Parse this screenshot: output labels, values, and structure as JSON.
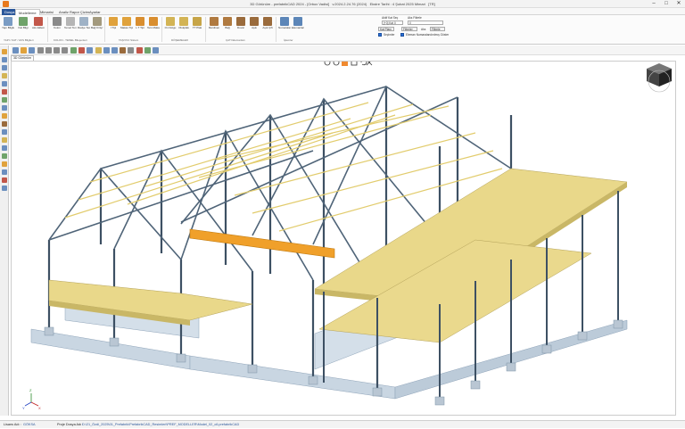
{
  "app": {
    "title": "3D Görünüm - prefabrikCAD 2024 - [Orbox Vadisi]",
    "version": "v.2024.2.24.76 (2024)",
    "license": "Ekstre Tarihi : 4 Şubat 2025 Mimari",
    "mode": "[TR]",
    "window_controls": [
      "–",
      "□",
      "✕"
    ]
  },
  "menu_tabs": [
    "Dosya",
    "Modelleme",
    "Mimarisi",
    "Analiz Rapor Çizim",
    "Ayarlar"
  ],
  "ribbon": {
    "buttons": [
      {
        "label": "Yapı Bilgileri",
        "icon": "building-icon"
      },
      {
        "label": "Kat Bilgi",
        "icon": "floor-info-icon"
      },
      {
        "label": "Aks Ekleme",
        "icon": "axis-icon"
      },
      {
        "label": "Kolon",
        "icon": "column-icon"
      },
      {
        "label": "Temel Temeli",
        "icon": "foundation-icon"
      },
      {
        "label": "Radye Temeli",
        "icon": "raft-icon"
      },
      {
        "label": "Bağ Kirişi Temeli",
        "icon": "tie-beam-icon"
      },
      {
        "label": "I Tipi",
        "icon": "i-beam-icon"
      },
      {
        "label": "Makas Tipi",
        "icon": "truss-icon"
      },
      {
        "label": "L T Tipi",
        "icon": "lt-beam-icon"
      },
      {
        "label": "Ters Makas Kirişi",
        "icon": "inverted-truss-icon"
      },
      {
        "label": "Ön Dolgu",
        "icon": "infill-icon"
      },
      {
        "label": "Olukplak",
        "icon": "hollowcore-icon"
      },
      {
        "label": "TT Plak",
        "icon": "tt-slab-icon"
      },
      {
        "label": "Merdiven",
        "icon": "stair-icon"
      },
      {
        "label": "Bağ",
        "icon": "tie-icon"
      },
      {
        "label": "Duvar",
        "icon": "wall-icon"
      },
      {
        "label": "Aşık",
        "icon": "purlin-icon"
      },
      {
        "label": "Aşık Çift",
        "icon": "purlin-double-icon"
      },
      {
        "label": "Numaralandır",
        "icon": "numbering-icon"
      },
      {
        "label": "Elemanları Değiştir",
        "icon": "edit-elements-icon"
      }
    ],
    "groups": [
      "YAPI / KAT / AKS Bilgileri",
      "KOLON - TEMEL Bileşenleri",
      "TAŞIYICI Sistem",
      "DÖŞEMELER",
      "ÇATI Elemanları",
      "İşlemler"
    ],
    "floor_label": "Aktif Kat Seç",
    "floor_value": "[+0] Kat 0",
    "layer_label": "Aks Filtrele",
    "layer_value": "0",
    "btn_plan": "Kat Planı",
    "btn_filter": "Filtreler",
    "btn_axis": "Aks",
    "btn_filter2": "Filtrele",
    "chk_selected": "Seçimler",
    "chk_numbered": "Eleman Numaralandırılmış Göster"
  },
  "view": {
    "tab": "3D Görünüm",
    "axis_labels": {
      "x": "X",
      "y": "Y",
      "z": "Z"
    }
  },
  "status": {
    "user_label": "Lisans Adı :",
    "user_value": "GÖKSA",
    "path_label": "Proje Dosya Adı :",
    "path_value": "D:\\21_Özdi_2025\\01_Prefabrik\\PrefabrikCAD_Resimleri\\PREF_MODELLER\\Model_02_c6.prefabrikCAD"
  },
  "colors": {
    "steel": "#4f6478",
    "slab": "#e9d88a",
    "slab_dark": "#c9b766",
    "footing": "#c9d6e2",
    "highlight": "#f0a02a",
    "accent": "#2b579a"
  }
}
